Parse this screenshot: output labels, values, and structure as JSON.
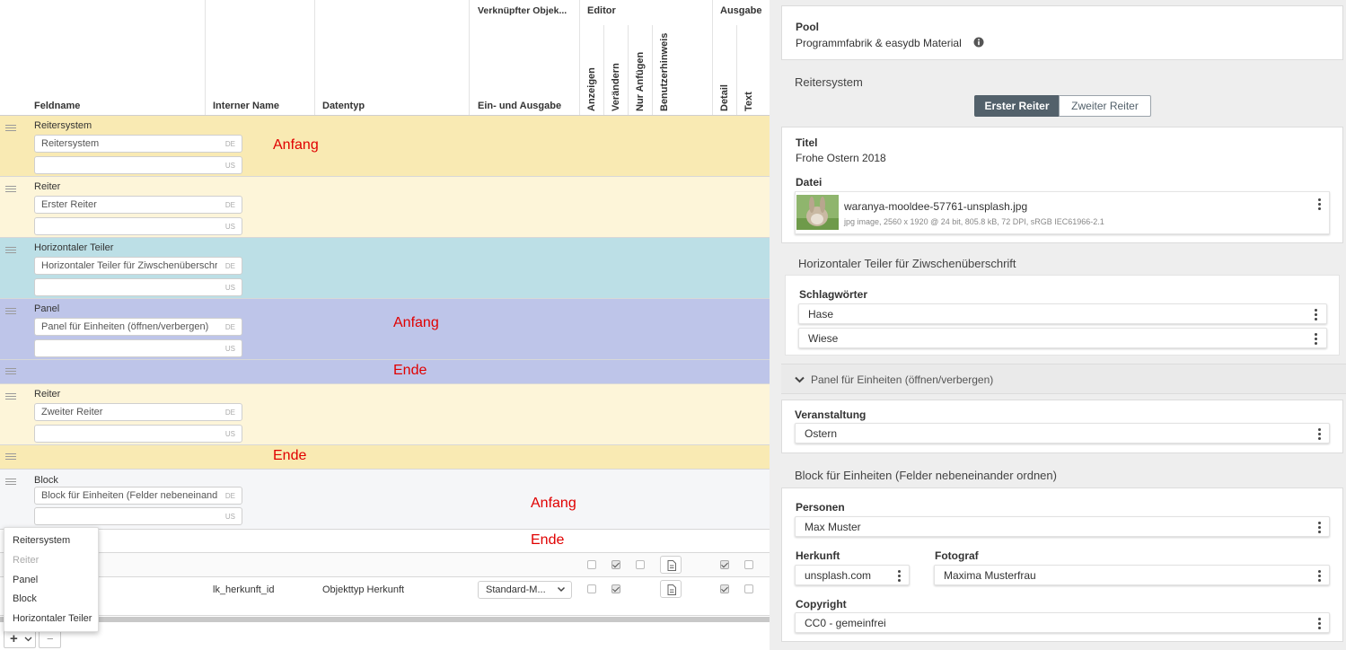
{
  "table": {
    "headers": {
      "feldname": "Feldname",
      "interner_name": "Interner Name",
      "datentyp": "Datentyp",
      "verknuepfter": "Verknüpfter Objek...",
      "ein_ausgabe": "Ein- und Ausgabe",
      "editor": "Editor",
      "ausgabe": "Ausgabe",
      "anzeigen": "Anzeigen",
      "veraendern": "Verändern",
      "nur_anfuegen": "Nur Anfügen",
      "benutzerhinweis": "Benutzerhinweis",
      "detail": "Detail",
      "text": "Text"
    },
    "rows": [
      {
        "label": "Reitersystem",
        "de": "Reitersystem",
        "de_tag": "DE",
        "us_tag": "US"
      },
      {
        "label": "Reiter",
        "de": "Erster Reiter",
        "de_tag": "DE",
        "us_tag": "US"
      },
      {
        "label": "Horizontaler Teiler",
        "de": "Horizontaler Teiler für Ziwschenüberschri",
        "de_tag": "DE",
        "us_tag": "US"
      },
      {
        "label": "Panel",
        "de": "Panel für Einheiten (öffnen/verbergen)",
        "de_tag": "DE",
        "us_tag": "US"
      },
      {
        "label": "Reiter",
        "de": "Zweiter Reiter",
        "de_tag": "DE",
        "us_tag": "US"
      },
      {
        "label": "Block",
        "de": "Block für Einheiten (Felder nebeneinande",
        "de_tag": "DE",
        "us_tag": "US"
      }
    ],
    "field_row": {
      "internal_name": "lk_herkunft_id",
      "datatype": "Objekttyp Herkunft",
      "select_value": "Standard-M..."
    },
    "annotations": {
      "anfang": "Anfang",
      "ende": "Ende"
    },
    "add_menu": [
      "Reitersystem",
      "Reiter",
      "Panel",
      "Block",
      "Horizontaler Teiler"
    ],
    "bottom": {
      "plus": "+",
      "minus": "−"
    }
  },
  "detail": {
    "pool_label": "Pool",
    "pool_value": "Programmfabrik & easydb Material",
    "reitersystem_title": "Reitersystem",
    "tabs": [
      "Erster Reiter",
      "Zweiter Reiter"
    ],
    "titel_label": "Titel",
    "titel_value": "Frohe Ostern 2018",
    "datei_label": "Datei",
    "file_name": "waranya-mooldee-57761-unsplash.jpg",
    "file_meta": "jpg image,  2560 x 1920 @ 24 bit,  805.8 kB,  72 DPI,  sRGB IEC61966-2.1",
    "divider_title": "Horizontaler Teiler für Ziwschenüberschrift",
    "schlagwoerter_label": "Schlagwörter",
    "tags": [
      "Hase",
      "Wiese"
    ],
    "panel_title": "Panel für Einheiten (öffnen/verbergen)",
    "veranstaltung_label": "Veranstaltung",
    "veranstaltung_value": "Ostern",
    "block_title": "Block für Einheiten (Felder nebeneinander ordnen)",
    "personen_label": "Personen",
    "personen_value": "Max Muster",
    "herkunft_label": "Herkunft",
    "herkunft_value": "unsplash.com",
    "fotograf_label": "Fotograf",
    "fotograf_value": "Maxima Musterfrau",
    "copyright_label": "Copyright",
    "copyright_value": "CC0 - gemeinfrei"
  },
  "colors": {
    "yellow": "#f9eab3",
    "light_yellow": "#fdf5d9",
    "blue": "#bcdfe6",
    "purple": "#bec5e9",
    "grey_row": "#f5f6f8",
    "tab_active": "#53616b",
    "annotation_red": "#e00000"
  }
}
